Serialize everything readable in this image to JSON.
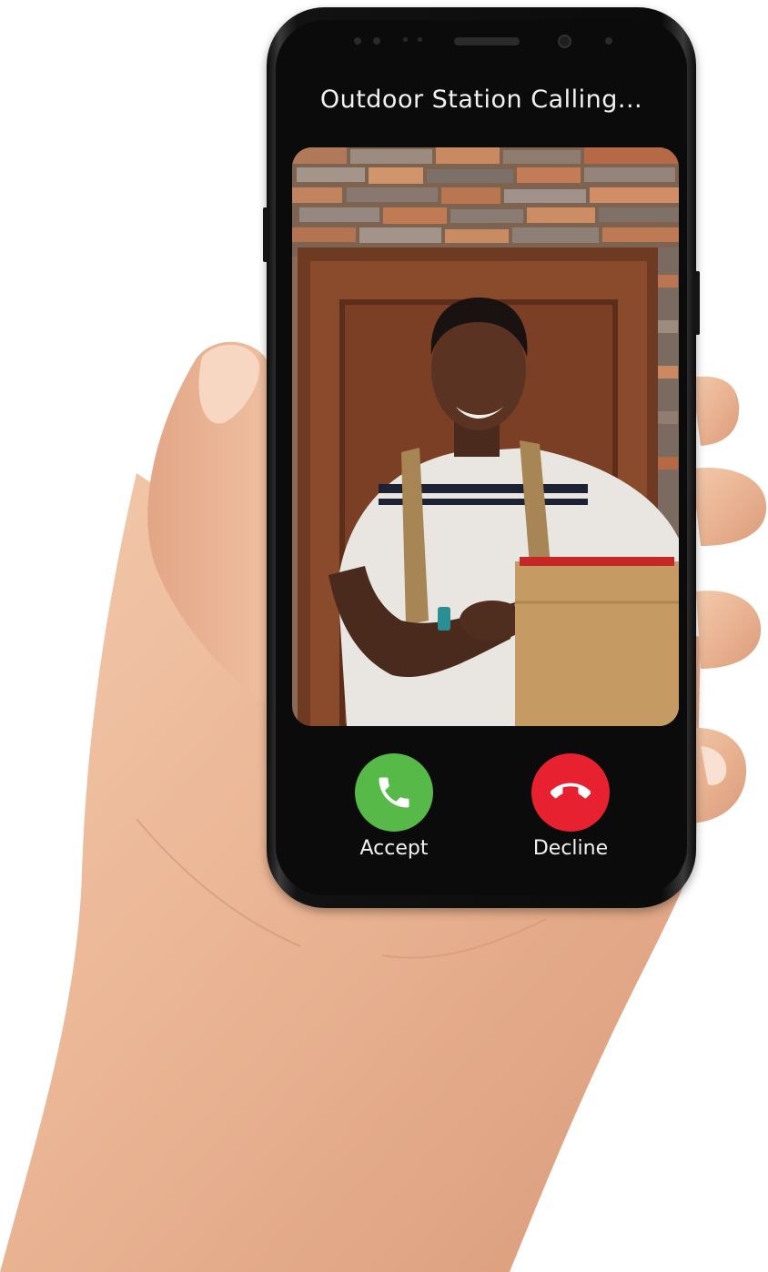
{
  "call": {
    "title": "Outdoor Station Calling...",
    "accept_label": "Accept",
    "decline_label": "Decline"
  },
  "colors": {
    "accept": "#57b948",
    "decline": "#e7212f",
    "screen_background": "#0b0b0b",
    "text": "#f2f2f2"
  },
  "icons": {
    "accept": "phone-icon",
    "decline": "phone-hangup-icon"
  }
}
